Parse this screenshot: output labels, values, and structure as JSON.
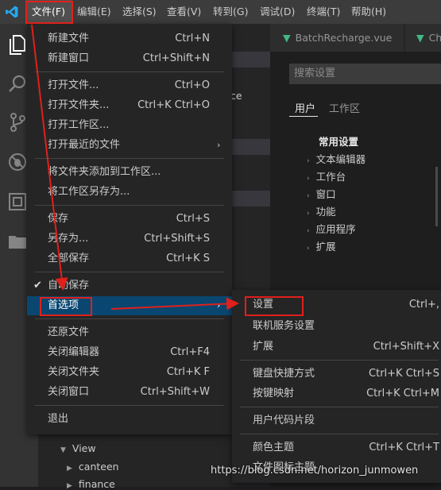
{
  "menubar": {
    "items": [
      "文件(F)",
      "编辑(E)",
      "选择(S)",
      "查看(V)",
      "转到(G)",
      "调试(D)",
      "终端(T)",
      "帮助(H)"
    ]
  },
  "tabs": [
    {
      "label": "BatchRecharge.vue"
    },
    {
      "label": "Ch"
    }
  ],
  "settings": {
    "search_placeholder": "搜索设置",
    "tabs": [
      "用户",
      "工作区"
    ],
    "section_title": "常用设置",
    "tree": [
      "文本编辑器",
      "工作台",
      "窗口",
      "功能",
      "应用程序",
      "扩展"
    ]
  },
  "sidebar": {
    "fragment": "ce",
    "tree": [
      "View",
      "canteen",
      "finance"
    ]
  },
  "file_menu": {
    "groups": [
      [
        {
          "label": "新建文件",
          "shortcut": "Ctrl+N"
        },
        {
          "label": "新建窗口",
          "shortcut": "Ctrl+Shift+N"
        }
      ],
      [
        {
          "label": "打开文件...",
          "shortcut": "Ctrl+O"
        },
        {
          "label": "打开文件夹...",
          "shortcut": "Ctrl+K Ctrl+O"
        },
        {
          "label": "打开工作区...",
          "shortcut": ""
        },
        {
          "label": "打开最近的文件",
          "shortcut": ""
        }
      ],
      [
        {
          "label": "将文件夹添加到工作区...",
          "shortcut": ""
        },
        {
          "label": "将工作区另存为...",
          "shortcut": ""
        }
      ],
      [
        {
          "label": "保存",
          "shortcut": "Ctrl+S"
        },
        {
          "label": "另存为...",
          "shortcut": "Ctrl+Shift+S"
        },
        {
          "label": "全部保存",
          "shortcut": "Ctrl+K S"
        }
      ],
      [
        {
          "label": "自动保存",
          "shortcut": ""
        },
        {
          "label": "首选项",
          "shortcut": ""
        }
      ],
      [
        {
          "label": "还原文件",
          "shortcut": ""
        },
        {
          "label": "关闭编辑器",
          "shortcut": "Ctrl+F4"
        },
        {
          "label": "关闭文件夹",
          "shortcut": "Ctrl+K F"
        },
        {
          "label": "关闭窗口",
          "shortcut": "Ctrl+Shift+W"
        }
      ],
      [
        {
          "label": "退出",
          "shortcut": ""
        }
      ]
    ]
  },
  "pref_menu": {
    "groups": [
      [
        {
          "label": "设置",
          "shortcut": "Ctrl+,"
        },
        {
          "label": "联机服务设置",
          "shortcut": ""
        },
        {
          "label": "扩展",
          "shortcut": "Ctrl+Shift+X"
        }
      ],
      [
        {
          "label": "键盘快捷方式",
          "shortcut": "Ctrl+K Ctrl+S"
        },
        {
          "label": "按键映射",
          "shortcut": "Ctrl+K Ctrl+M"
        }
      ],
      [
        {
          "label": "用户代码片段",
          "shortcut": ""
        }
      ],
      [
        {
          "label": "颜色主题",
          "shortcut": "Ctrl+K Ctrl+T"
        },
        {
          "label": "文件图标主题",
          "shortcut": ""
        }
      ]
    ]
  },
  "watermark": "https://blog.csdn.net/horizon_junmowen",
  "colors": {
    "accent_highlight": "#094771",
    "annotation_red": "#e0201b",
    "vscode_blue": "#23a9f2"
  }
}
